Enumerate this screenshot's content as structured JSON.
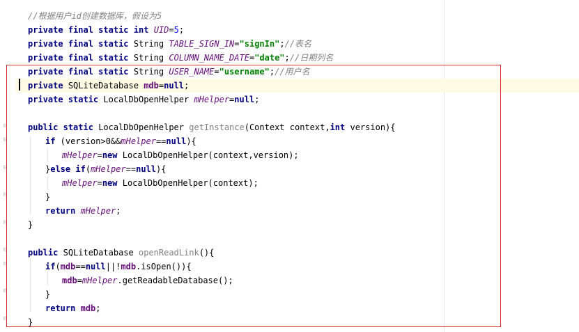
{
  "code_lines": {
    "l1": "//根据用户id创建数据库，假设为5",
    "l2": "private final static int UID=5;",
    "l3": "private final static String TABLE_SIGN_IN=\"signIn\";//表名",
    "l4": "private final static String COLUMN_NAME_DATE=\"date\";//日期列名",
    "l5": "private final static String USER_NAME=\"username\";//用户名",
    "l6": "private SQLiteDatabase mdb=null;",
    "l7": "private static LocalDbOpenHelper mHelper=null;",
    "l8": "public static LocalDbOpenHelper getInstance(Context context,int version){",
    "l9": "if (version>0&&mHelper==null){",
    "l10": "mHelper=new LocalDbOpenHelper(context,version);",
    "l11": "}else if(mHelper==null){",
    "l12": "mHelper=new LocalDbOpenHelper(context);",
    "l13": "}",
    "l14": "return mHelper;",
    "l15": "}",
    "l16": "public SQLiteDatabase openReadLink(){",
    "l17": "if(mdb==null||!mdb.isOpen()){",
    "l18": "mdb=mHelper.getReadableDatabase();",
    "l19": "}",
    "l20": "return mdb;",
    "l21": "}"
  },
  "tokens": {
    "comment_header": "//根据用户id创建数据库，假设为5",
    "private": "private",
    "final": "final",
    "static": "static",
    "int": "int",
    "string_type": "String",
    "uid_field": "UID",
    "uid_value": "5",
    "table_sign_in_field": "TABLE_SIGN_IN",
    "sign_in_str": "\"signIn\"",
    "comment_table": "//表名",
    "column_name_date_field": "COLUMN_NAME_DATE",
    "date_str": "\"date\"",
    "comment_date": "//日期列名",
    "user_name_field": "USER_NAME",
    "username_str": "\"username\"",
    "comment_user": "//用户名",
    "sqlite_type": "SQLiteDatabase",
    "mdb": "mdb",
    "null": "null",
    "helper_type": "LocalDbOpenHelper",
    "mhelper": "mHelper",
    "public": "public",
    "get_instance": "getInstance",
    "context_param": "(Context context,",
    "version_param": " version){",
    "if": "if",
    "version_cond": " (version>0&&",
    "new": "new",
    "ctor_ctx_ver": " LocalDbOpenHelper(context,version);",
    "else": "else",
    "ctor_ctx": " LocalDbOpenHelper(context);",
    "return": "return",
    "open_read_link": "openReadLink",
    "is_open": ".isOpen()){",
    "get_readable": ".getReadableDatabase();"
  }
}
